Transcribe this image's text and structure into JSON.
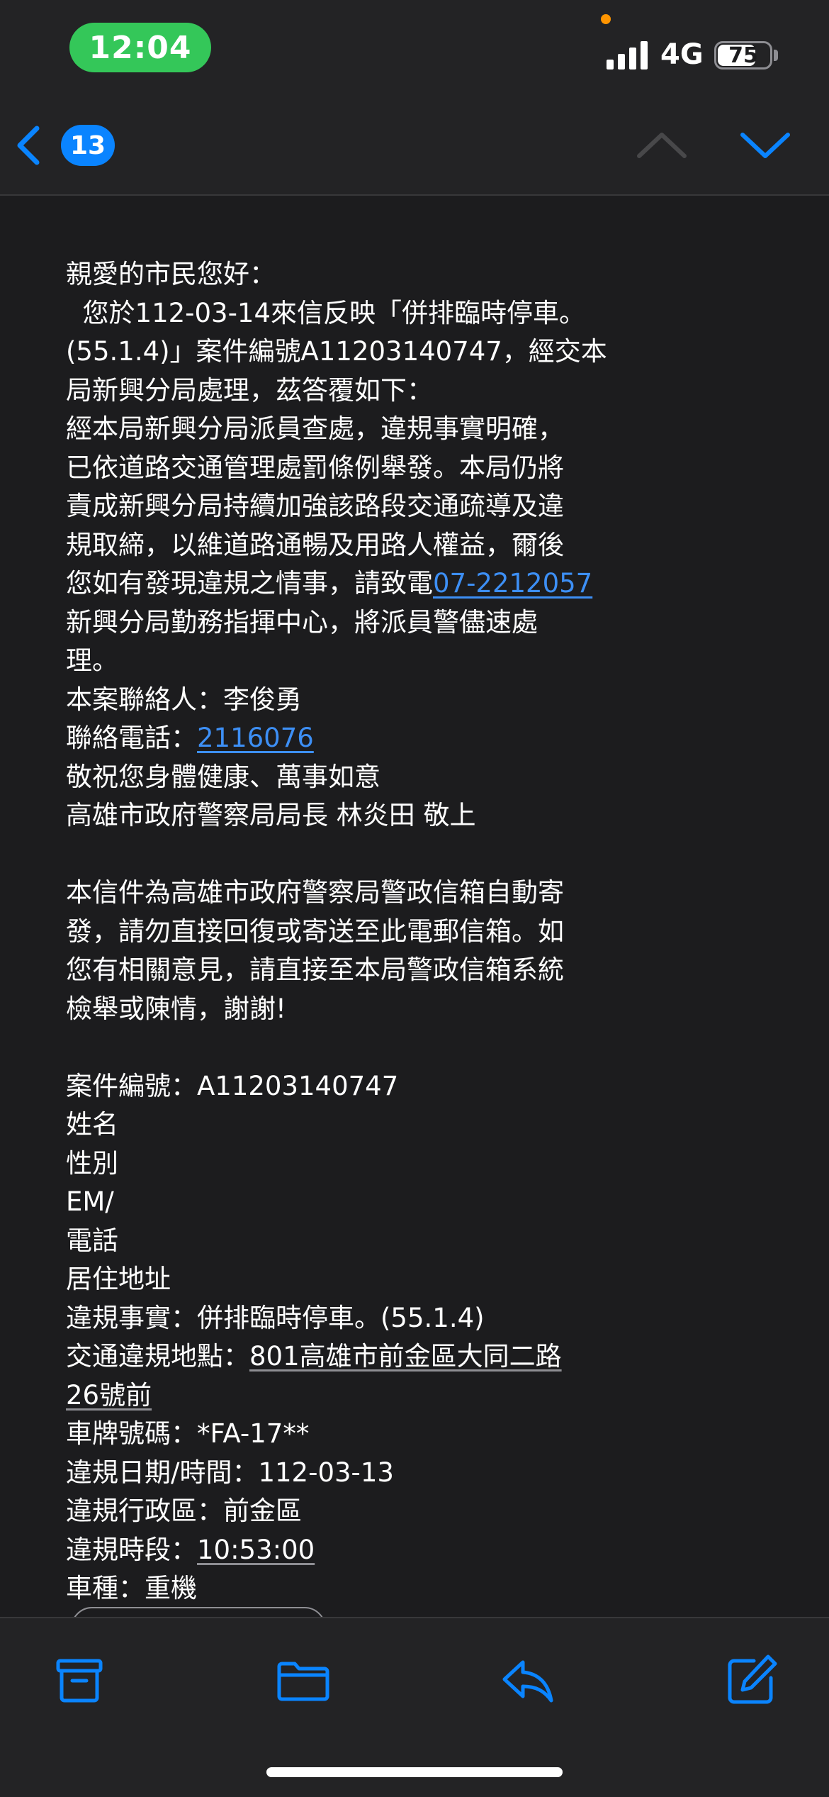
{
  "status_bar": {
    "time": "12:04",
    "network": "4G",
    "battery": "75",
    "battery_level": 0.75
  },
  "nav": {
    "back_count": "13",
    "icons": {
      "back": "chevron-left-icon",
      "up": "chevron-up-icon",
      "down": "chevron-down-icon"
    }
  },
  "email": {
    "greeting": "親愛的市民您好：",
    "intro_line1": "  您於112-03-14來信反映「併排臨時停車。",
    "intro_line2": "(55.1.4)」案件編號A11203140747，經交本",
    "intro_line3": "局新興分局處理，茲答覆如下：",
    "reply_line1": "經本局新興分局派員查處，違規事實明確，",
    "reply_line2": "已依道路交通管理處罰條例舉發。本局仍將",
    "reply_line3": "責成新興分局持續加強該路段交通疏導及違",
    "reply_line4": "規取締，以維道路通暢及用路人權益，爾後",
    "reply_line5_prefix": "您如有發現違規之情事，請致電",
    "reply_phone_link": "07-2212057",
    "reply_line6": "新興分局勤務指揮中心，將派員警儘速處",
    "reply_line7": "理。",
    "contact_person": "本案聯絡人：李俊勇",
    "contact_phone_label": "聯絡電話：",
    "contact_phone_link": "2116076",
    "wishes": "敬祝您身體健康、萬事如意",
    "signature": "高雄市政府警察局局長 林炎田 敬上",
    "notice_line1": "本信件為高雄市政府警察局警政信箱自動寄",
    "notice_line2": "發，請勿直接回復或寄送至此電郵信箱。如",
    "notice_line3": "您有相關意見，請直接至本局警政信箱系統",
    "notice_line4": "檢舉或陳情，謝謝!",
    "case_number": "案件編號：A11203140747",
    "name_label": "姓名",
    "gender_label": "性別",
    "email_label": "EM/",
    "phone_label": "電話",
    "address_label": "居住地址",
    "violation_fact": "違規事實：併排臨時停車。(55.1.4)",
    "location_label": "交通違規地點：",
    "location_value_1": "801高雄市前金區大同二路",
    "location_value_2": "26號前",
    "plate": "車牌號碼：*FA-17**",
    "date": "違規日期/時間：112-03-13",
    "district": "違規行政區：前金區",
    "time_label": "違規時段：",
    "time_value": "10:53:00",
    "vehicle": "車種：重機"
  },
  "toolbar": {
    "items": [
      {
        "name": "archive",
        "icon": "archive-icon"
      },
      {
        "name": "move-to-folder",
        "icon": "folder-icon"
      },
      {
        "name": "reply",
        "icon": "reply-icon"
      },
      {
        "name": "compose",
        "icon": "compose-icon"
      }
    ]
  },
  "colors": {
    "accent": "#0a84ff",
    "status_green": "#34c759",
    "background": "#1c1c1e",
    "link": "#3d8ff5"
  }
}
